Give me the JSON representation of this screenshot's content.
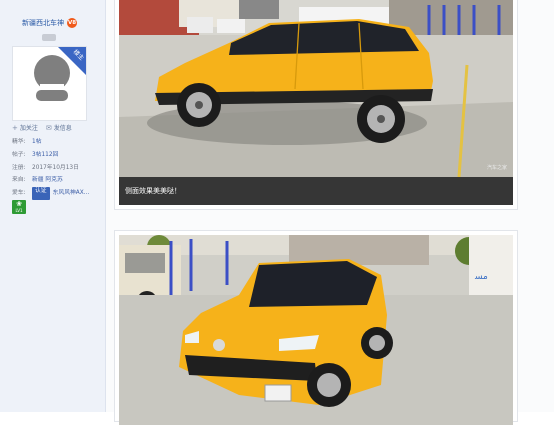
{
  "user": {
    "username": "新疆西北车神",
    "level_badge": "V8",
    "avatar_ribbon": "楼主",
    "actions": [
      {
        "label": "加关注",
        "icon": "plus-icon"
      },
      {
        "label": "发信息",
        "icon": "message-icon"
      }
    ],
    "info": {
      "essence_label": "精华:",
      "essence_value": "1帖",
      "posts_label": "帖子:",
      "posts_value": "3帖112回",
      "reg_label": "注册:",
      "reg_value": "2017年10月13日",
      "from_label": "来自:",
      "from_value": "新疆 阿克苏",
      "car_label": "爱车:",
      "car_tag": "认证",
      "car_value": "东风风神AX..."
    },
    "medal_label": "LV1"
  },
  "posts": [
    {
      "caption": "侧面效果美美哒！",
      "watermark": "汽车之家"
    },
    {
      "caption": "",
      "watermark": ""
    }
  ],
  "colors": {
    "car_body": "#f6b21a",
    "link_blue": "#2a5aa6",
    "sidebar_bg": "#eef2f9"
  }
}
